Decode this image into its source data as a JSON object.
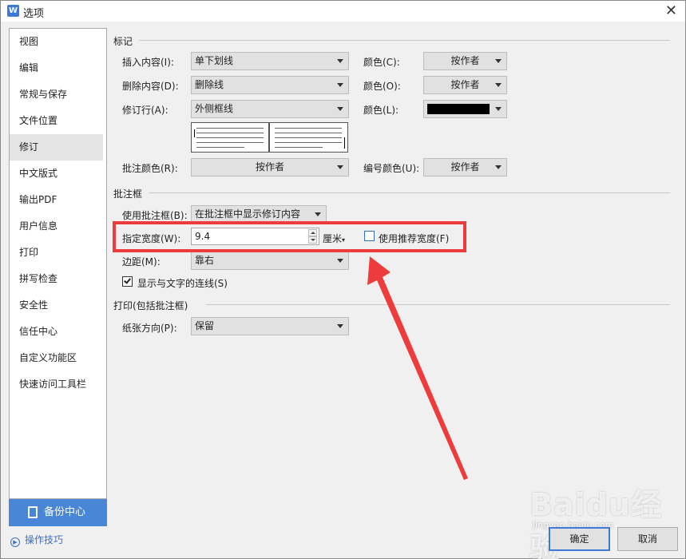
{
  "window": {
    "title": "选项",
    "app_icon_letter": "W"
  },
  "sidebar": {
    "items": [
      {
        "label": "视图"
      },
      {
        "label": "编辑"
      },
      {
        "label": "常规与保存"
      },
      {
        "label": "文件位置"
      },
      {
        "label": "修订"
      },
      {
        "label": "中文版式"
      },
      {
        "label": "输出PDF"
      },
      {
        "label": "用户信息"
      },
      {
        "label": "打印"
      },
      {
        "label": "拼写检查"
      },
      {
        "label": "安全性"
      },
      {
        "label": "信任中心"
      },
      {
        "label": "自定义功能区"
      },
      {
        "label": "快速访问工具栏"
      }
    ],
    "active_index": 4,
    "backup_label": "备份中心",
    "tips_label": "操作技巧"
  },
  "markup": {
    "section_title": "标记",
    "insert_label": "插入内容(I):",
    "insert_value": "单下划线",
    "insert_color_label": "颜色(C):",
    "insert_color_value": "按作者",
    "delete_label": "删除内容(D):",
    "delete_value": "删除线",
    "delete_color_label": "颜色(O):",
    "delete_color_value": "按作者",
    "revline_label": "修订行(A):",
    "revline_value": "外侧框线",
    "revline_color_label": "颜色(L):",
    "revline_color_value": "#000000",
    "comment_color_label": "批注颜色(R):",
    "comment_color_value": "按作者",
    "number_color_label": "编号颜色(U):",
    "number_color_value": "按作者"
  },
  "balloon": {
    "section_title": "批注框",
    "use_label": "使用批注框(B):",
    "use_value": "在批注框中显示修订内容",
    "width_label": "指定宽度(W):",
    "width_value": "9.4",
    "unit_value": "厘米",
    "recommended_label": "使用推荐宽度(F)",
    "recommended_checked": false,
    "margin_label": "边距(M):",
    "margin_value": "靠右",
    "show_lines_label": "显示与文字的连线(S)",
    "show_lines_checked": true
  },
  "print": {
    "section_title": "打印(包括批注框)",
    "orientation_label": "纸张方向(P):",
    "orientation_value": "保留"
  },
  "buttons": {
    "ok": "确定",
    "cancel": "取消"
  },
  "watermark": {
    "main": "Baidu经验",
    "sub": "jingyan.baidu.com"
  },
  "annotation_color": "#ee3b3b"
}
